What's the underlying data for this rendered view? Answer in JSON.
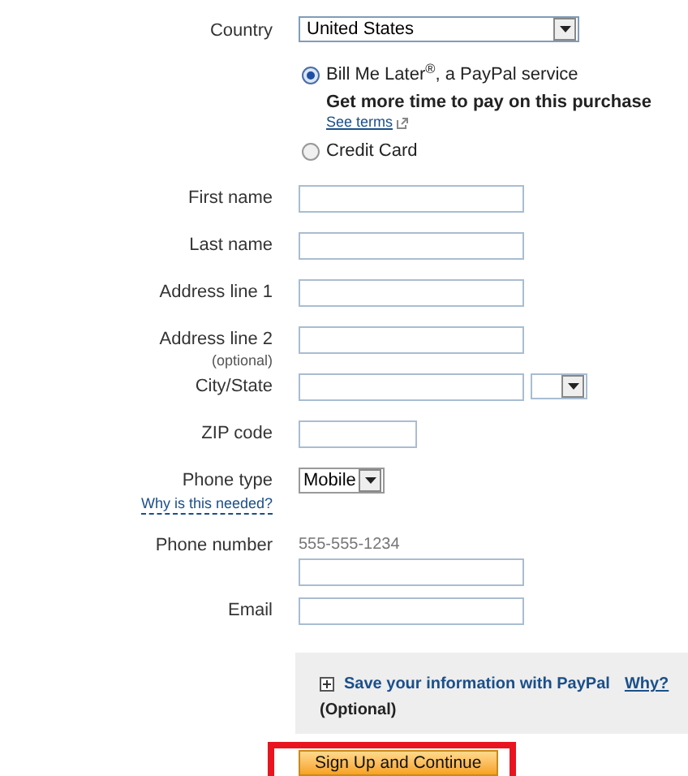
{
  "country": {
    "label": "Country",
    "value": "United States"
  },
  "payment_options": [
    {
      "label": "Bill Me Later$^{®}$, a PayPal service",
      "selected": true,
      "detail": "Get more time to pay on this purchase",
      "link": "See terms"
    },
    {
      "label": "Credit Card",
      "selected": false
    }
  ],
  "fields": [
    {
      "kind": "text",
      "label": "First name"
    },
    {
      "kind": "text",
      "label": "Last name"
    },
    {
      "kind": "text",
      "label": "Address line 1"
    },
    {
      "kind": "text",
      "label": "Address line 2",
      "note": "(optional)"
    },
    {
      "kind": "city",
      "label": "City/State"
    },
    {
      "kind": "zip",
      "label": "ZIP code"
    },
    {
      "kind": "select",
      "label": "Phone type",
      "value": "Mobile",
      "link": "Why is this needed?"
    },
    {
      "kind": "text",
      "label": "Phone number",
      "hint": "555-555-1234"
    },
    {
      "kind": "text",
      "label": "Email"
    }
  ],
  "save_info": {
    "expanded": false,
    "title": "Save your information with PayPal",
    "link": "Why?",
    "note": "(Optional)"
  },
  "submit": {
    "label": "Sign Up and Continue",
    "highlighted": true
  }
}
